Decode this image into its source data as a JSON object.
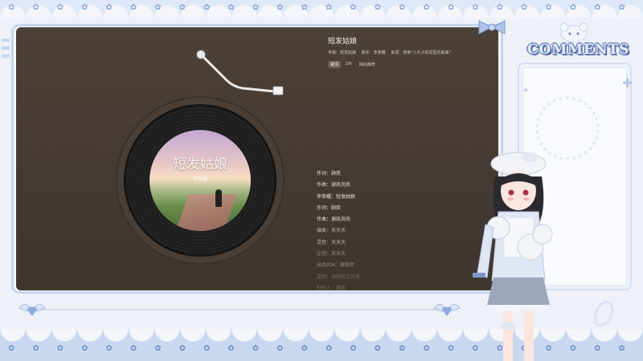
{
  "song": {
    "title": "短发姑娘",
    "meta": [
      "专辑：短发姑娘",
      "歌手：李荣耀",
      "来源：搜索\"小丸子的发型的歌曲\""
    ],
    "tabs": [
      {
        "label": "歌词",
        "active": true
      },
      {
        "label": "DH",
        "active": false
      },
      {
        "label": "相似推荐",
        "active": false
      }
    ]
  },
  "cover": {
    "title": "短发姑娘",
    "artist": "李荣耀"
  },
  "lyrics": [
    "作词：顾奕",
    "作曲：谢凯尚尚",
    "李荣耀：短发姑娘",
    "作词：顾奕",
    "作曲：谢凯尚尚",
    "编曲：天天天",
    "混音：天天天",
    "企划：天天天",
    "出品/OA：谢俊辉",
    "监制：谷映和工作室",
    "制作人：谢凯"
  ],
  "comments": {
    "title": "COMMENTS"
  },
  "colors": {
    "player_bg": "#433932",
    "frame": "#c7d5ee",
    "accent": "#5f79b5"
  },
  "icons": [
    "tonearm-icon",
    "star-icon",
    "winged-heart-icon",
    "bow-icon",
    "cross-icon"
  ]
}
